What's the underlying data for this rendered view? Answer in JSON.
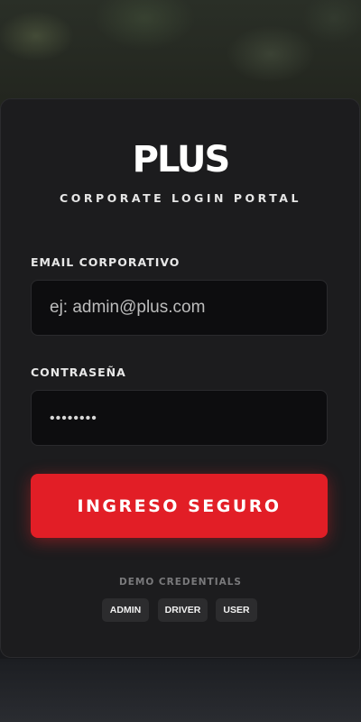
{
  "brand": {
    "logo_text": "PLUS",
    "subtitle": "CORPORATE LOGIN PORTAL"
  },
  "form": {
    "email": {
      "label": "EMAIL CORPORATIVO",
      "placeholder": "ej: admin@plus.com",
      "value": ""
    },
    "password": {
      "label": "CONTRASEÑA",
      "masked_value": "••••••••"
    },
    "submit_label": "INGRESO SEGURO"
  },
  "demo": {
    "title": "DEMO CREDENTIALS",
    "buttons": [
      {
        "label": "ADMIN"
      },
      {
        "label": "DRIVER"
      },
      {
        "label": "USER"
      }
    ]
  },
  "colors": {
    "accent": "#e21e26",
    "card": "#1c1c1e",
    "input_bg": "#0d0d0f"
  }
}
